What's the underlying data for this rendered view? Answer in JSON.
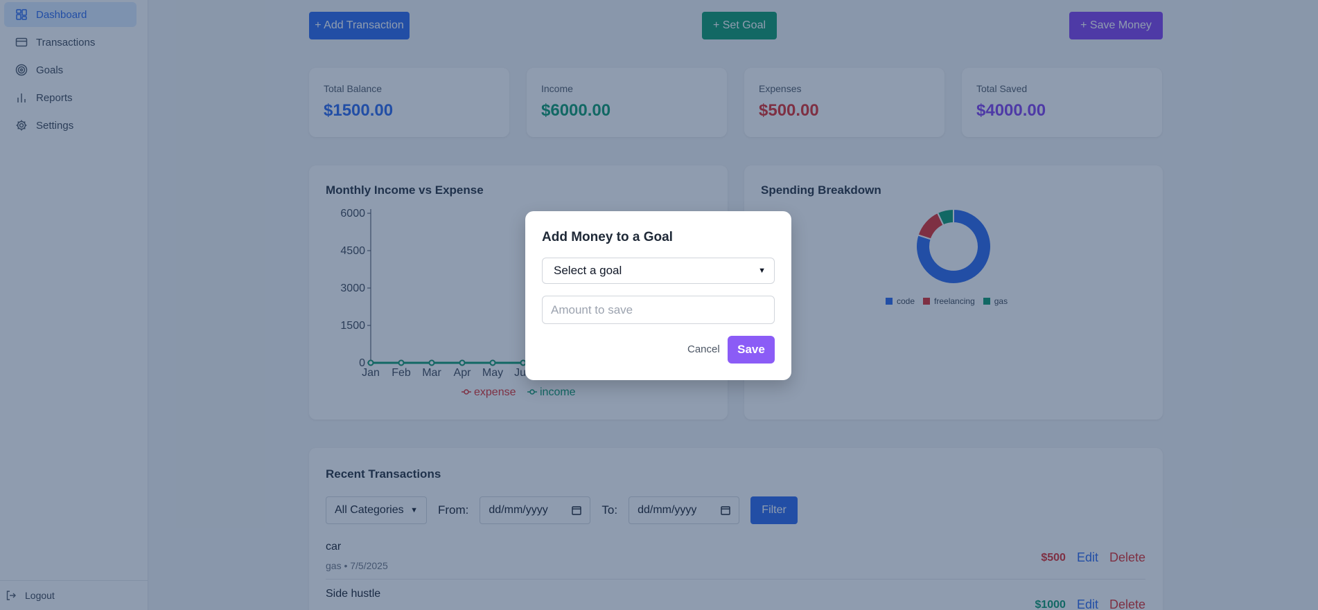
{
  "sidebar": {
    "items": [
      {
        "label": "Dashboard",
        "icon": "grid-icon"
      },
      {
        "label": "Transactions",
        "icon": "card-icon"
      },
      {
        "label": "Goals",
        "icon": "target-icon"
      },
      {
        "label": "Reports",
        "icon": "bar-chart-icon"
      },
      {
        "label": "Settings",
        "icon": "gear-icon"
      }
    ],
    "logout_label": "Logout"
  },
  "toolbar": {
    "add_transaction": "+ Add Transaction",
    "set_goal": "+ Set Goal",
    "save_money": "+ Save Money"
  },
  "summary": {
    "total_balance_label": "Total Balance",
    "total_balance_value": "$1500.00",
    "income_label": "Income",
    "income_value": "$6000.00",
    "expenses_label": "Expenses",
    "expenses_value": "$500.00",
    "total_saved_label": "Total Saved",
    "total_saved_value": "$4000.00"
  },
  "colors": {
    "primary": "#2563eb",
    "income": "#059669",
    "expense": "#dc2626",
    "saved": "#7c3aed"
  },
  "chart_data": [
    {
      "type": "line",
      "title": "Monthly Income vs Expense",
      "x": [
        "Jan",
        "Feb",
        "Mar",
        "Apr",
        "May",
        "Jun"
      ],
      "series": [
        {
          "name": "expense",
          "values": [
            0,
            0,
            0,
            0,
            0,
            0
          ],
          "color": "#dc2626"
        },
        {
          "name": "income",
          "values": [
            0,
            0,
            0,
            0,
            0,
            0
          ],
          "color": "#059669"
        }
      ],
      "yticks": [
        "0",
        "1500",
        "3000",
        "4500",
        "6000"
      ],
      "ylim": [
        0,
        6000
      ],
      "legend": "bottom"
    },
    {
      "type": "pie",
      "title": "Spending Breakdown",
      "labels": [
        "code",
        "freelancing",
        "gas"
      ],
      "values": [
        80,
        13,
        7
      ],
      "colors": [
        "#2563eb",
        "#dc2626",
        "#059669"
      ],
      "legend": "bottom"
    }
  ],
  "transactions": {
    "title": "Recent Transactions",
    "category_select": "All Categories",
    "from_label": "From:",
    "to_label": "To:",
    "date_placeholder": "dd/mm/yyyy",
    "filter_label": "Filter",
    "edit_label": "Edit",
    "delete_label": "Delete",
    "rows": [
      {
        "name": "car",
        "meta": "gas • 7/5/2025",
        "amount": "$500",
        "color": "#dc2626"
      },
      {
        "name": "Side hustle",
        "meta": "",
        "amount": "$1000",
        "color": "#059669"
      }
    ]
  },
  "modal": {
    "title": "Add Money to a Goal",
    "select_value": "Select a goal",
    "amount_placeholder": "Amount to save",
    "cancel_label": "Cancel",
    "save_label": "Save"
  }
}
